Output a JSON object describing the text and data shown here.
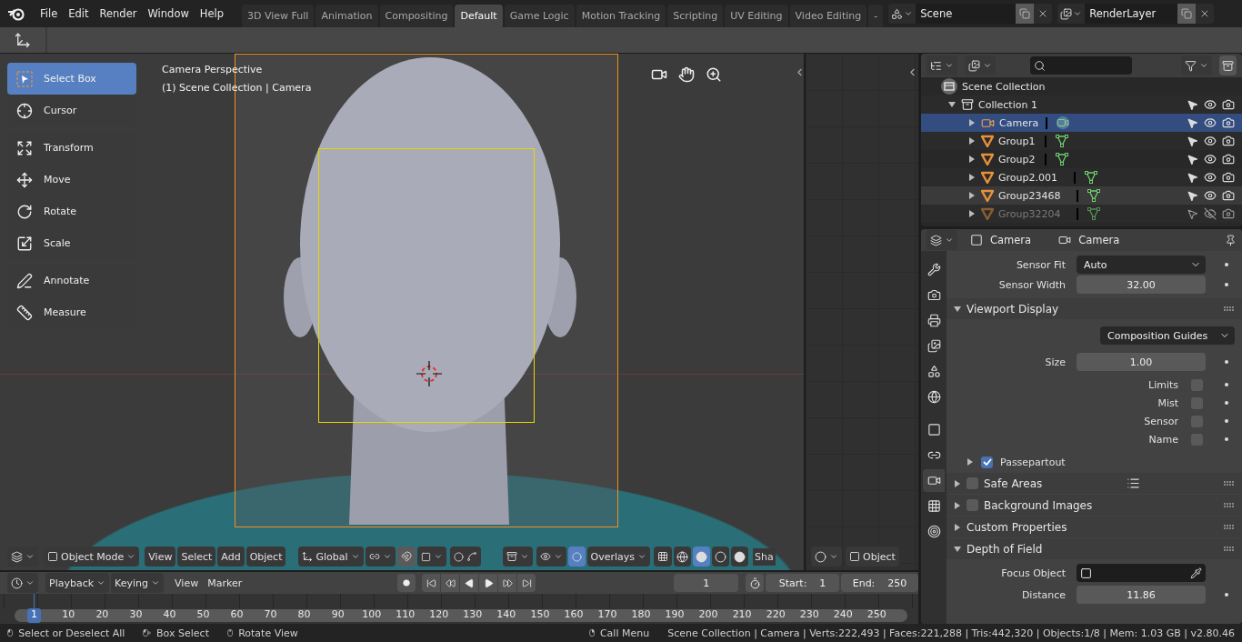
{
  "menu": [
    "File",
    "Edit",
    "Render",
    "Window",
    "Help"
  ],
  "workspaces": [
    {
      "label": "3D View Full",
      "selected": false
    },
    {
      "label": "Animation",
      "selected": false
    },
    {
      "label": "Compositing",
      "selected": false
    },
    {
      "label": "Default",
      "selected": true
    },
    {
      "label": "Game Logic",
      "selected": false
    },
    {
      "label": "Motion Tracking",
      "selected": false
    },
    {
      "label": "Scripting",
      "selected": false
    },
    {
      "label": "UV Editing",
      "selected": false
    },
    {
      "label": "Video Editing",
      "selected": false
    },
    {
      "label": "-",
      "selected": false
    }
  ],
  "scene": "Scene",
  "view_layer": "RenderLayer",
  "tool_groups": [
    [
      {
        "label": "Select Box",
        "kind": "select",
        "selected": true
      },
      {
        "label": "Cursor",
        "kind": "cursor",
        "selected": false
      }
    ],
    [
      {
        "label": "Transform",
        "kind": "transform",
        "selected": false
      },
      {
        "label": "Move",
        "kind": "move",
        "selected": false
      },
      {
        "label": "Rotate",
        "kind": "rotate",
        "selected": false
      },
      {
        "label": "Scale",
        "kind": "scale",
        "selected": false
      }
    ],
    [
      {
        "label": "Annotate",
        "kind": "annotate",
        "selected": false
      },
      {
        "label": "Measure",
        "kind": "measure",
        "selected": false
      }
    ]
  ],
  "viewport": {
    "title": "Camera Perspective",
    "subtitle": "(1) Scene Collection | Camera"
  },
  "viewport_header": {
    "mode": "Object Mode",
    "menus": [
      "View",
      "Select",
      "Add",
      "Object"
    ],
    "orientation": "Global",
    "overlays": "Overlays",
    "shading": [
      {
        "kind": "wireframe",
        "selected": false
      },
      {
        "kind": "solid",
        "selected": true
      },
      {
        "kind": "material",
        "selected": false
      },
      {
        "kind": "rendered",
        "selected": false
      }
    ],
    "cut_label": "Sha"
  },
  "side_header": {
    "label": "Object"
  },
  "outliner": {
    "items": [
      {
        "label": "Scene Collection",
        "kind": "scene",
        "children": [
          {
            "label": "Collection 1",
            "kind": "collection",
            "expanded": true,
            "children": [
              {
                "label": "Camera",
                "kind": "camera",
                "selected": true,
                "hovered": false,
                "disabled": false
              },
              {
                "label": "Group1",
                "kind": "mesh",
                "selected": false,
                "hovered": false,
                "disabled": false
              },
              {
                "label": "Group2",
                "kind": "mesh",
                "selected": false,
                "hovered": false,
                "disabled": false
              },
              {
                "label": "Group2.001",
                "kind": "mesh",
                "selected": false,
                "hovered": false,
                "disabled": false
              },
              {
                "label": "Group23468",
                "kind": "mesh",
                "selected": false,
                "hovered": true,
                "disabled": false
              },
              {
                "label": "Group32204",
                "kind": "mesh",
                "selected": false,
                "hovered": false,
                "disabled": true
              }
            ]
          }
        ]
      }
    ]
  },
  "properties": {
    "tabs": [
      {
        "kind": "tool",
        "selected": false
      },
      {
        "kind": "render",
        "selected": false
      },
      {
        "kind": "output",
        "selected": false
      },
      {
        "kind": "view_layer",
        "selected": false
      },
      {
        "kind": "scene",
        "selected": false
      },
      {
        "kind": "world",
        "selected": false
      },
      {
        "kind": "object",
        "selected": false
      },
      {
        "kind": "constraints",
        "selected": false
      },
      {
        "kind": "data",
        "selected": true
      },
      {
        "kind": "texture",
        "selected": false
      },
      {
        "kind": "physics",
        "selected": false
      }
    ],
    "breadcrumb": [
      {
        "kind": "object",
        "label": "Camera"
      },
      {
        "kind": "data",
        "label": "Camera"
      }
    ],
    "items": [
      {
        "kind": "select",
        "label": "Sensor Fit",
        "value": "Auto"
      },
      {
        "kind": "number",
        "label": "Sensor Width",
        "value": "32.00"
      },
      {
        "kind": "panel",
        "label": "Viewport Display",
        "expanded": true
      },
      {
        "kind": "select",
        "value": "Composition Guides"
      },
      {
        "kind": "number",
        "label": "Size",
        "value": "1.00"
      },
      {
        "kind": "checkbox",
        "label": "Limits",
        "checked": false
      },
      {
        "kind": "checkbox",
        "label": "Mist",
        "checked": false
      },
      {
        "kind": "checkbox",
        "label": "Sensor",
        "checked": false
      },
      {
        "kind": "checkbox",
        "label": "Name",
        "checked": false
      },
      {
        "kind": "subpanel",
        "label": "Passepartout",
        "checked": true,
        "expanded": false
      },
      {
        "kind": "panel",
        "label": "Safe Areas",
        "checked": false,
        "expanded": false,
        "presets": true
      },
      {
        "kind": "panel",
        "label": "Background Images",
        "checked": false,
        "expanded": false
      },
      {
        "kind": "panel",
        "label": "Custom Properties",
        "expanded": false
      },
      {
        "kind": "panel",
        "label": "Depth of Field",
        "expanded": true
      },
      {
        "kind": "object",
        "label": "Focus Object"
      },
      {
        "kind": "number",
        "label": "Distance",
        "value": "11.86"
      }
    ]
  },
  "timeline": {
    "menus": [
      {
        "label": "Playback",
        "dropdown": true
      },
      {
        "label": "Keying",
        "dropdown": true
      },
      {
        "label": "View",
        "dropdown": false
      },
      {
        "label": "Marker",
        "dropdown": false
      }
    ],
    "current_frame": "1",
    "start_label": "Start:",
    "start": "1",
    "end_label": "End:",
    "end": "250",
    "ruler_current": "1",
    "ruler": [
      "10",
      "20",
      "30",
      "40",
      "50",
      "60",
      "70",
      "80",
      "90",
      "100",
      "110",
      "120",
      "130",
      "140",
      "150",
      "160",
      "170",
      "180",
      "190",
      "200",
      "210",
      "220",
      "230",
      "240",
      "250"
    ]
  },
  "status": {
    "hints": [
      {
        "kind": "left",
        "label": "Select or Deselect All"
      },
      {
        "kind": "drag",
        "label": "Box Select"
      },
      {
        "kind": "middle",
        "label": "Rotate View"
      },
      {
        "kind": "right",
        "label": "Call Menu"
      }
    ],
    "stats": "Scene Collection | Camera | Verts:222,493 | Faces:221,288 | Tris:442,320 | Objects:1/8 | Mem: 1.03 GB | v2.80.46"
  }
}
